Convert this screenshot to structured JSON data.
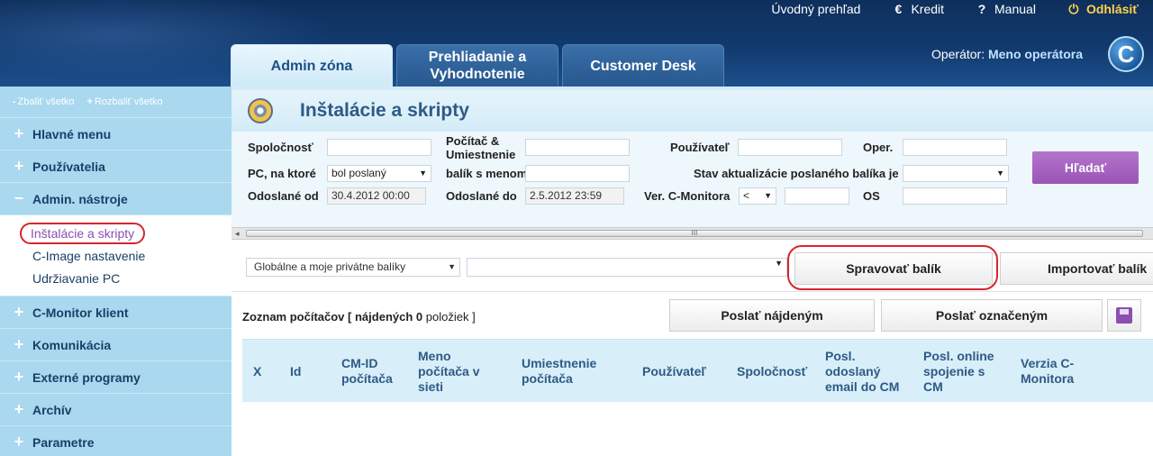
{
  "topnav": {
    "overview": "Úvodný prehľad",
    "credit": "Kredit",
    "manual": "Manual",
    "logout": "Odhlásiť"
  },
  "tabs": [
    {
      "label": "Admin zóna",
      "active": true
    },
    {
      "label": "Prehliadanie a Vyhodnotenie",
      "active": false
    },
    {
      "label": "Customer Desk",
      "active": false
    }
  ],
  "operator": {
    "label": "Operátor:",
    "name": "Meno operátora"
  },
  "logo_letter": "C",
  "sidebar": {
    "collapse_all": "Zbaliť všetko",
    "expand_all": "Rozbaliť všetko",
    "items": [
      {
        "label": "Hlavné menu",
        "symbol": "+"
      },
      {
        "label": "Používatelia",
        "symbol": "+"
      },
      {
        "label": "Admin. nástroje",
        "symbol": "−"
      }
    ],
    "sub_items": [
      "Inštalácie a skripty",
      "C-Image nastavenie",
      "Udržiavanie PC"
    ],
    "items_after": [
      {
        "label": "C-Monitor klient",
        "symbol": "+"
      },
      {
        "label": "Komunikácia",
        "symbol": "+"
      },
      {
        "label": "Externé programy",
        "symbol": "+"
      },
      {
        "label": "Archív",
        "symbol": "+"
      },
      {
        "label": "Parametre",
        "symbol": "+"
      }
    ]
  },
  "page": {
    "title": "Inštalácie a skripty"
  },
  "filters": {
    "company_label": "Spoločnosť",
    "computer_label": "Počítač & Umiestnenie",
    "user_label": "Používateľ",
    "oper_label": "Oper.",
    "pc_label": "PC, na ktoré",
    "pc_value": "bol poslaný",
    "package_label": "balík s menom",
    "update_state_label": "Stav aktualizácie poslaného balíka je",
    "sent_from_label": "Odoslané od",
    "sent_from_value": "30.4.2012 00:00",
    "sent_to_label": "Odoslané do",
    "sent_to_value": "2.5.2012 23:59",
    "cmon_version_label": "Ver. C-Monitora",
    "cmon_op_value": "<",
    "os_label": "OS",
    "search_button": "Hľadať"
  },
  "scroll": {
    "grip": "III"
  },
  "packages": {
    "scope_value": "Globálne a moje privátne balíky",
    "manage_button": "Spravovať balík",
    "import_button": "Importovať balík"
  },
  "list": {
    "title": "Zoznam počítačov",
    "found_prefix": "[ nájdených",
    "found_count": "0",
    "found_suffix": "položiek ]",
    "send_found_button": "Poslať nájdeným",
    "send_marked_button": "Poslať označeným",
    "columns": [
      "X",
      "Id",
      "CM-ID počítača",
      "Meno počítača v sieti",
      "Umiestnenie počítača",
      "Používateľ",
      "Spoločnosť",
      "Posl. odoslaný email do CM",
      "Posl. online spojenie s CM",
      "Verzia C-Monitora"
    ]
  }
}
